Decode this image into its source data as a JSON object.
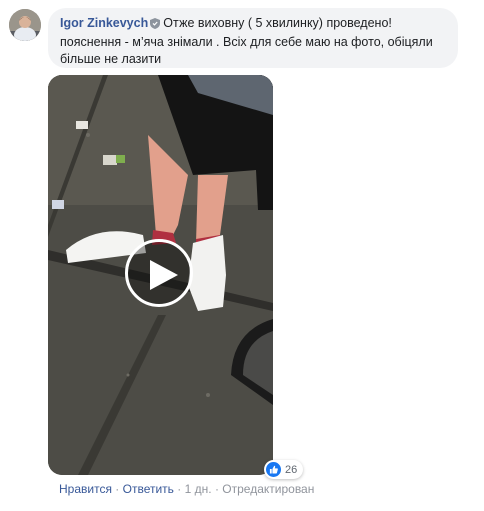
{
  "comment": {
    "author": "Igor Zinkevych",
    "text": "Отже виховну ( 5 хвилинку) проведено! пояснення - м’яча знімали . Всіх для себе маю на фото, обіцяли більше не лазити",
    "reaction_count": "26"
  },
  "actions": {
    "like": "Нравится",
    "reply": "Ответить",
    "time": "1 дн.",
    "edited": "Отредактирован",
    "separator": "·"
  },
  "colors": {
    "author_link": "#385898",
    "bubble_bg": "#f2f3f5",
    "like_badge": "#1877f2"
  }
}
